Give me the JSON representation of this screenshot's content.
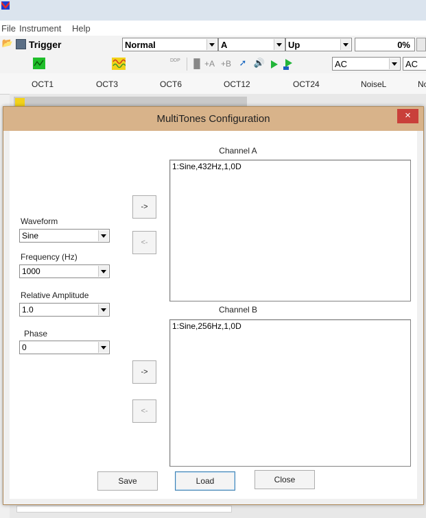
{
  "app": {
    "menu": [
      "File",
      "Instrument",
      "Help"
    ],
    "toolbar1": {
      "trigger_label": "Trigger",
      "mode": "Normal",
      "channel": "A",
      "slope": "Up",
      "percent": "0%"
    },
    "toolbar2": {
      "coupling_a": "AC",
      "coupling_b": "AC",
      "ch_a_icon_text": "+A",
      "ch_b_icon_text": "+B",
      "ddp_icon_text": "DDP"
    },
    "octaves": [
      "OCT1",
      "OCT3",
      "OCT6",
      "OCT12",
      "OCT24",
      "NoiseL",
      "No"
    ]
  },
  "dialog": {
    "title": "MultiTones Configuration",
    "close_glyph": "×",
    "waveform_label": "Waveform",
    "waveform_value": "Sine",
    "frequency_label": "Frequency (Hz)",
    "frequency_value": "1000",
    "amplitude_label": "Relative Amplitude",
    "amplitude_value": "1.0",
    "phase_label": "Phase",
    "phase_value": "0",
    "add_label": "->",
    "remove_label": "<-",
    "channel_a": {
      "title": "Channel A",
      "items": [
        "1:Sine,432Hz,1,0D"
      ]
    },
    "channel_b": {
      "title": "Channel B",
      "items": [
        "1:Sine,256Hz,1,0D"
      ]
    },
    "save_label": "Save",
    "load_label": "Load",
    "close_label": "Close"
  },
  "colors": {
    "dialog_title_bar": "#d8b38a",
    "close_button": "#c9403a"
  }
}
